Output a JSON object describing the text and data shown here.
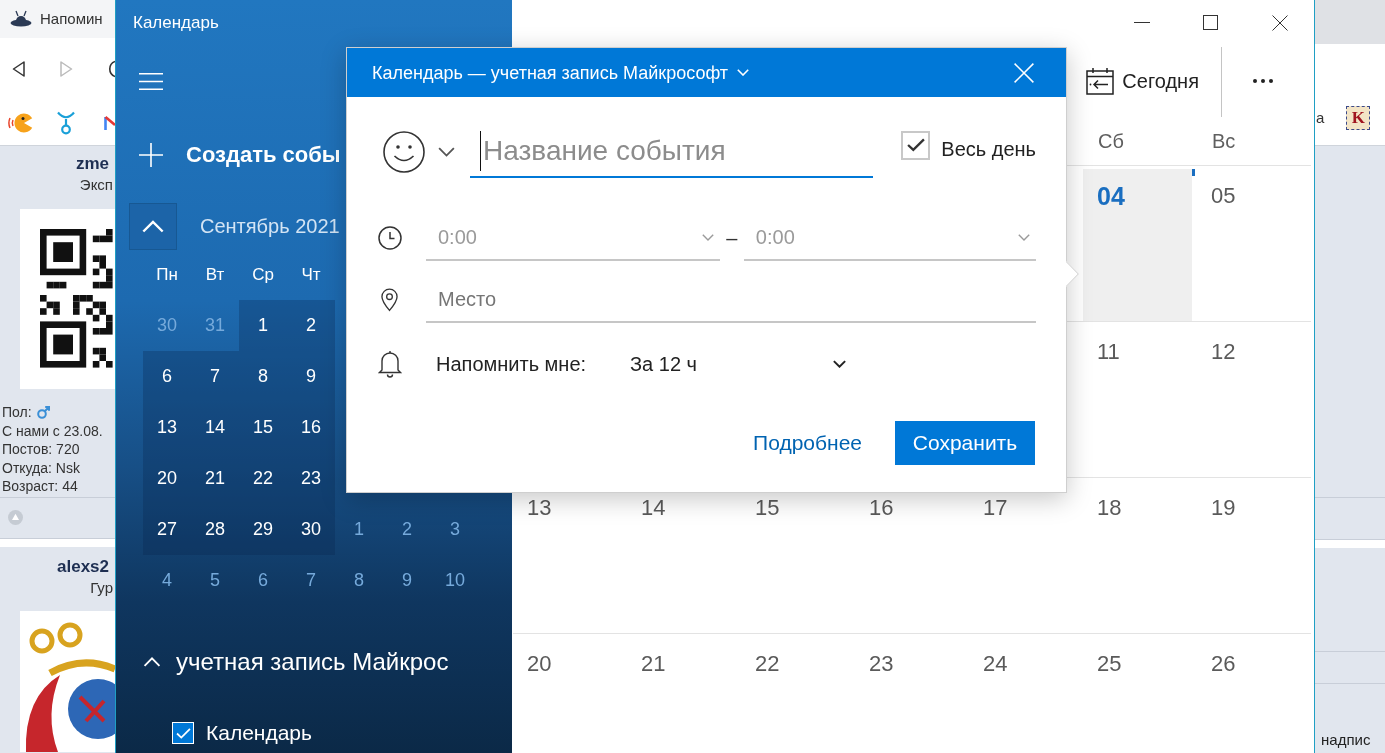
{
  "browser": {
    "tab_title": "Напомин",
    "posts": [
      {
        "author": "zme",
        "rank": "Эксп",
        "avatar": {
          "kind": "qr"
        },
        "profile": [
          {
            "kind": "gender",
            "text": "Пол:"
          },
          {
            "kind": "text",
            "text": "С нами с 23.08."
          },
          {
            "kind": "text",
            "text": "Постов: 720"
          },
          {
            "kind": "text",
            "text": "Откуда: Nsk"
          },
          {
            "kind": "text",
            "text": "Возраст: 44"
          }
        ]
      },
      {
        "author": "alexs2",
        "rank": "Гур",
        "avatar": {
          "kind": "emblem"
        }
      }
    ],
    "bookmark_text": "а",
    "bookmark_logo": "K",
    "side_text": "надпис"
  },
  "app": {
    "title": "Календарь",
    "new_event": "Создать собы",
    "mini_calendar": {
      "month": "Сентябрь 2021",
      "weekdays": [
        "Пн",
        "Вт",
        "Ср",
        "Чт"
      ],
      "weeks": [
        [
          {
            "day": "30",
            "in_month": false
          },
          {
            "day": "31",
            "in_month": false
          },
          {
            "day": "1",
            "in_month": true
          },
          {
            "day": "2",
            "in_month": true
          }
        ],
        [
          {
            "day": "6",
            "in_month": true
          },
          {
            "day": "7",
            "in_month": true
          },
          {
            "day": "8",
            "in_month": true
          },
          {
            "day": "9",
            "in_month": true
          }
        ],
        [
          {
            "day": "13",
            "in_month": true
          },
          {
            "day": "14",
            "in_month": true
          },
          {
            "day": "15",
            "in_month": true
          },
          {
            "day": "16",
            "in_month": true
          }
        ],
        [
          {
            "day": "20",
            "in_month": true
          },
          {
            "day": "21",
            "in_month": true
          },
          {
            "day": "22",
            "in_month": true
          },
          {
            "day": "23",
            "in_month": true
          }
        ],
        [
          {
            "day": "27",
            "in_month": true
          },
          {
            "day": "28",
            "in_month": true
          },
          {
            "day": "29",
            "in_month": true
          },
          {
            "day": "30",
            "in_month": true
          },
          {
            "day": "1",
            "in_month": false
          },
          {
            "day": "2",
            "in_month": false
          },
          {
            "day": "3",
            "in_month": false
          }
        ],
        [
          {
            "day": "4",
            "in_month": false
          },
          {
            "day": "5",
            "in_month": false
          },
          {
            "day": "6",
            "in_month": false
          },
          {
            "day": "7",
            "in_month": false
          },
          {
            "day": "8",
            "in_month": false
          },
          {
            "day": "9",
            "in_month": false
          },
          {
            "day": "10",
            "in_month": false
          }
        ]
      ]
    },
    "accounts": [
      {
        "name": "учетная запись Майкрос",
        "expanded": true,
        "calendars": [
          {
            "label": "Календарь",
            "checked": true
          }
        ]
      }
    ],
    "toolbar": {
      "today": "Сегодня"
    },
    "month_view": {
      "weekdays": [
        "Сб",
        "Вс"
      ],
      "weeks": [
        {
          "days": [
            {
              "day": "04",
              "today": true
            },
            {
              "day": "05",
              "today": false
            }
          ]
        },
        {
          "days": [
            {
              "day": "11",
              "today": false
            },
            {
              "day": "12",
              "today": false
            }
          ]
        },
        {
          "days": [
            {
              "day": "13",
              "today": false
            },
            {
              "day": "14",
              "today": false
            },
            {
              "day": "15",
              "today": false
            },
            {
              "day": "16",
              "today": false
            },
            {
              "day": "17",
              "today": false
            },
            {
              "day": "18",
              "today": false
            },
            {
              "day": "19",
              "today": false
            }
          ]
        },
        {
          "days": [
            {
              "day": "20",
              "today": false
            },
            {
              "day": "21",
              "today": false
            },
            {
              "day": "22",
              "today": false
            },
            {
              "day": "23",
              "today": false
            },
            {
              "day": "24",
              "today": false
            },
            {
              "day": "25",
              "today": false
            },
            {
              "day": "26",
              "today": false
            }
          ]
        }
      ]
    }
  },
  "dialog": {
    "title": "Календарь — учетная запись Майкрософт",
    "event_title": {
      "placeholder": "Название события"
    },
    "all_day": {
      "label": "Весь день",
      "checked": true
    },
    "start_time": {
      "value": "0:00",
      "disabled": true
    },
    "time_separator": "–",
    "end_time": {
      "value": "0:00",
      "disabled": true
    },
    "location": {
      "placeholder": "Место"
    },
    "reminder": {
      "label": "Напомнить мне:",
      "value": "За 12 ч"
    },
    "buttons": [
      {
        "label": "Подробнее",
        "kind": "link"
      },
      {
        "label": "Сохранить",
        "kind": "primary"
      }
    ]
  }
}
